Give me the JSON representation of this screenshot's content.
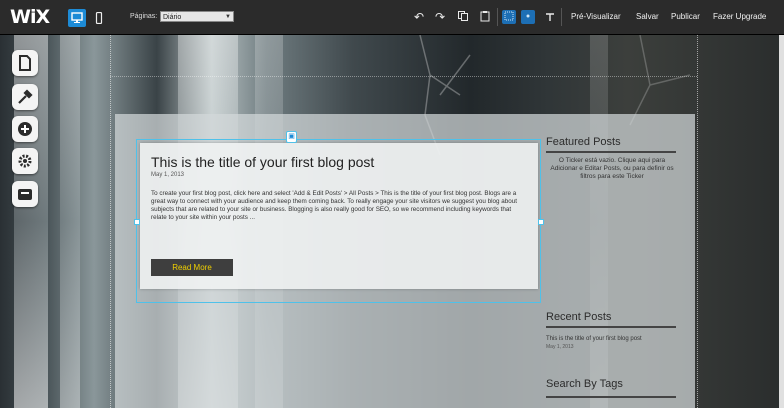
{
  "topbar": {
    "logo": "WiX",
    "pages_label": "Páginas:",
    "page_selected": "Diário",
    "menu": [
      "Pré-Visualizar",
      "Salvar",
      "Publicar",
      "Fazer Upgrade"
    ],
    "icons": [
      "undo-icon",
      "redo-icon",
      "copy-icon",
      "paste-icon",
      "grid-icon",
      "snap-icon",
      "ruler-icon"
    ]
  },
  "tools": [
    "pages-icon",
    "design-icon",
    "add-icon",
    "settings-icon",
    "app-market-icon"
  ],
  "post": {
    "title": "This is the title of your first blog post",
    "date": "May 1, 2013",
    "body": "To create your first blog post, click here and select 'Add & Edit Posts' > All Posts > This is the title of your first blog post. Blogs are a great way to connect with your audience and keep them coming back. To really engage your site visitors we suggest you blog about subjects that are related to your site or business. Blogging is also really good for SEO, so we recommend including keywords that relate to your site within your posts ...",
    "read_more": "Read More"
  },
  "sidebar": {
    "featured_title": "Featured Posts",
    "ticker_text": "O Ticker está vazio. Clique aqui para Adicionar e Editar Posts, ou para definir os filtros para este Ticker",
    "recent_title": "Recent Posts",
    "recent_item": "This is the title of your first blog post",
    "recent_date": "May 1, 2013",
    "tags_title": "Search By Tags"
  },
  "colors": {
    "accent": "#1d8bd6",
    "selection": "#4fc1e9",
    "read_more_text": "#f0d000"
  }
}
